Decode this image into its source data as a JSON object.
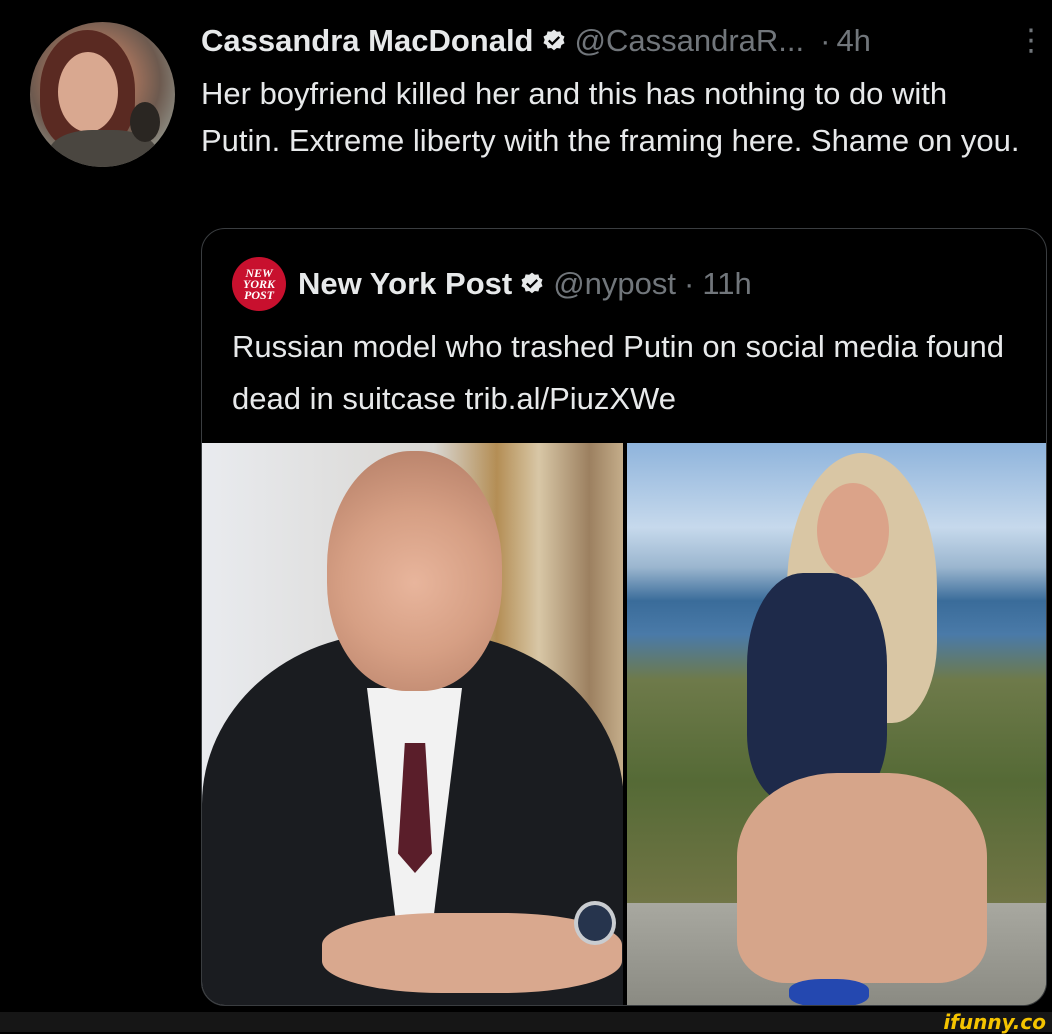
{
  "tweet": {
    "author_name": "Cassandra MacDonald",
    "handle": "@CassandraR...",
    "separator": "·",
    "time": "4h",
    "more_glyph": "⋮",
    "text": "Her boyfriend killed her and this has nothing to do with Putin. Extreme liberty with the framing here. Shame on you."
  },
  "quoted": {
    "author_name": "New York Post",
    "logo_text": "NEW\nYORK\nPOST",
    "handle": "@nypost",
    "separator": "·",
    "time": "11h",
    "text": "Russian model who trashed Putin on social media found dead in suitcase trib.al/PiuzXWe"
  },
  "watermark": {
    "text": "ifunny.co"
  },
  "colors": {
    "background": "#000000",
    "text_primary": "#e7e9ea",
    "text_secondary": "#71767b",
    "verified_badge": "#e7e9ea",
    "nypost_red": "#c8102e",
    "watermark_yellow": "#f5c400"
  }
}
